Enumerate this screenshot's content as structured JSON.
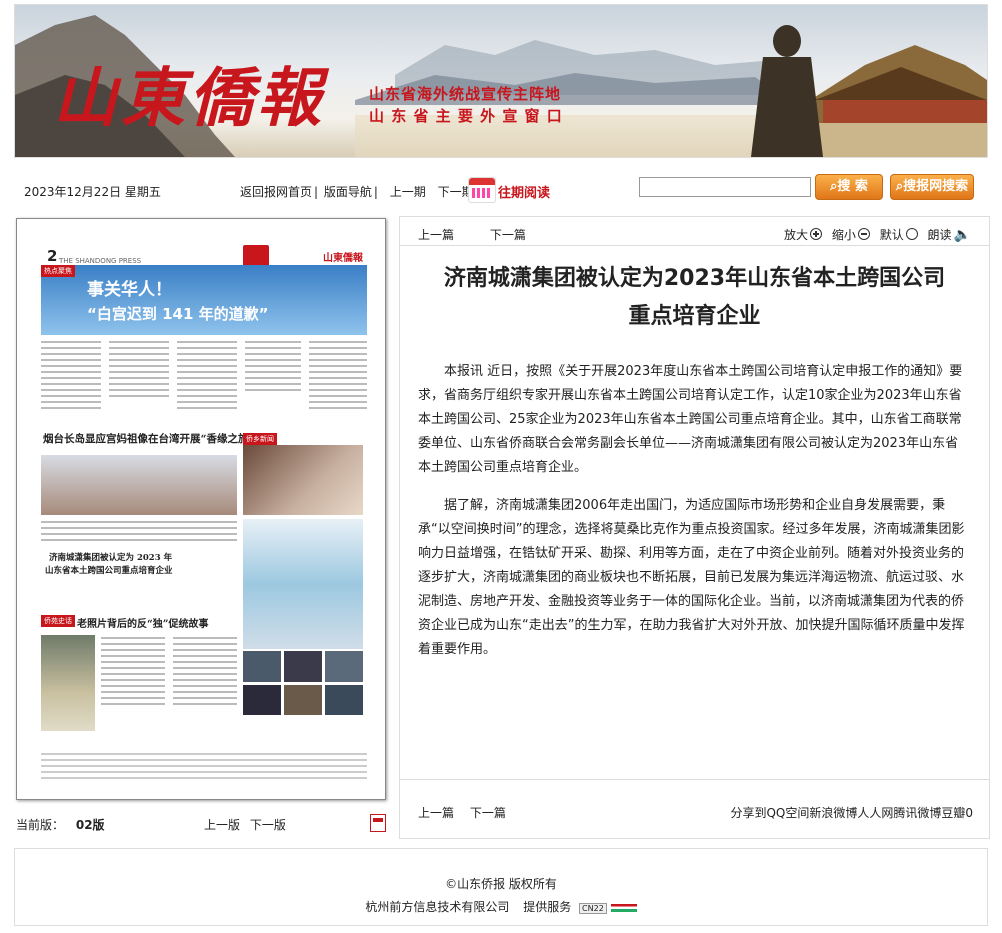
{
  "header": {
    "logo_text": "山東僑報",
    "slogan_line1": "山东省海外统战宣传主阵地",
    "slogan_line2": "山 东 省 主 要 外 宣 窗 口"
  },
  "toolbar": {
    "date": "2023年12月22日 星期五",
    "links": [
      "返回报网首页",
      "版面导航",
      "上一期",
      "下一期"
    ],
    "separators": [
      "|",
      "|"
    ],
    "past_reading": "往期阅读",
    "search_value": "",
    "search_button": "搜 索",
    "site_search_button": "搜报网搜索"
  },
  "left_panel": {
    "page_label": "当前版：",
    "page_number": "02版",
    "prev_page": "上一版",
    "next_page": "下一版",
    "pdf_icon": "pdf-icon",
    "thumbnail": {
      "page_no": "2",
      "paper_en": "THE SHANDONG PRESS",
      "masthead": "山東僑報",
      "section_tag1": "热点聚焦",
      "headline1": "事关华人！",
      "headline1b": "“白宫迟到 141 年的道歉”",
      "headline2": "烟台长岛显应宫妈祖像在台湾开展“香缘之旅”",
      "headline3a": "济南城潇集团被认定为 2023 年",
      "headline3b": "山东省本土跨国公司重点培育企业",
      "section_tag2": "侨乡新闻",
      "section_tag3": "侨苑史话",
      "headline4": "老照片背后的反“独”促统故事"
    }
  },
  "article": {
    "prev": "上一篇",
    "next": "下一篇",
    "zoom_in": "放大",
    "zoom_out": "缩小",
    "default": "默认",
    "read_aloud": "朗读",
    "title_line1": "济南城潇集团被认定为2023年山东省本土跨国公司",
    "title_line2": "重点培育企业",
    "paragraphs": [
      "本报讯 近日，按照《关于开展2023年度山东省本土跨国公司培育认定申报工作的通知》要求，省商务厅组织专家开展山东省本土跨国公司培育认定工作，认定10家企业为2023年山东省本土跨国公司、25家企业为2023年山东省本土跨国公司重点培育企业。其中，山东省工商联常委单位、山东省侨商联合会常务副会长单位——济南城潇集团有限公司被认定为2023年山东省本土跨国公司重点培育企业。",
      "据了解，济南城潇集团2006年走出国门，为适应国际市场形势和企业自身发展需要，秉承“以空间换时间”的理念，选择将莫桑比克作为重点投资国家。经过多年发展，济南城潇集团影响力日益增强，在锆钛矿开采、勘探、利用等方面，走在了中资企业前列。随着对外投资业务的逐步扩大，济南城潇集团的商业板块也不断拓展，目前已发展为集远洋海运物流、航运过驳、水泥制造、房地产开发、金融投资等业务于一体的国际化企业。当前，以济南城潇集团为代表的侨资企业已成为山东“走出去”的生力军，在助力我省扩大对外开放、加快提升国际循环质量中发挥着重要作用。"
    ],
    "share": "分享到QQ空间新浪微博人人网腾讯微博豆瓣0"
  },
  "footer": {
    "copyright": "©山东侨报 版权所有",
    "provider": "杭州前方信息技术有限公司",
    "service": "提供服务",
    "badge": "CN22"
  },
  "colors": {
    "brand_red": "#c8161d",
    "button_orange": "#f09030"
  }
}
